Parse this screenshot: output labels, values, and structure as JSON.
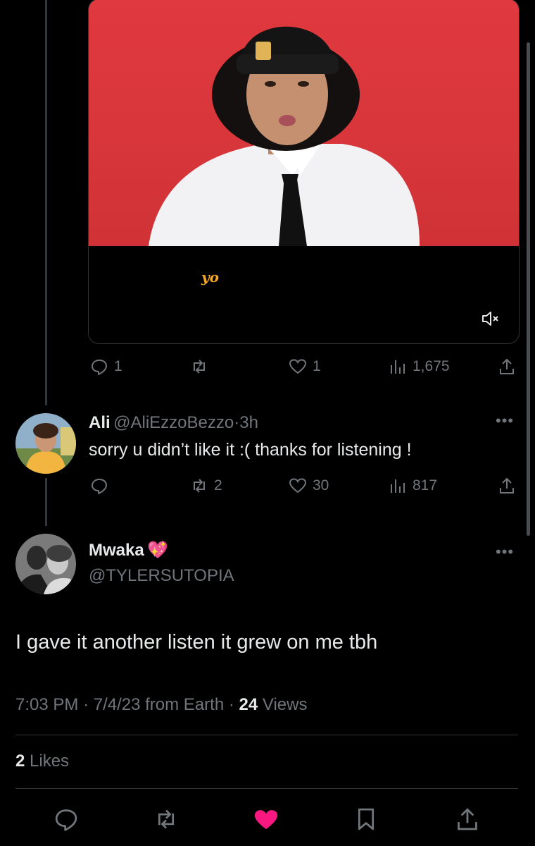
{
  "video": {
    "caption": "yo",
    "mute_icon": "volume-mute-icon"
  },
  "prev_tweet_actions": {
    "replies": "1",
    "retweets": "",
    "likes": "1",
    "views": "1,675"
  },
  "reply_tweet": {
    "name": "Ali",
    "handle": "@AliEzzoBezzo",
    "time": "3h",
    "text": "sorry u didn’t like it :( thanks for listening !",
    "retweets": "2",
    "likes": "30",
    "views": "817"
  },
  "main_tweet": {
    "name": "Mwaka",
    "name_emoji": "💖",
    "handle": "@TYLERSUTOPIA",
    "text": "I gave it another listen it grew on me tbh",
    "time": "7:03 PM",
    "date": "7/4/23",
    "source": "from Earth",
    "views_count": "24",
    "views_label": "Views",
    "likes_count": "2",
    "likes_label": "Likes"
  },
  "colors": {
    "like_active": "#f91880",
    "muted_text": "#71767b",
    "video_bg": "#d7363a",
    "caption": "#f5a623"
  }
}
